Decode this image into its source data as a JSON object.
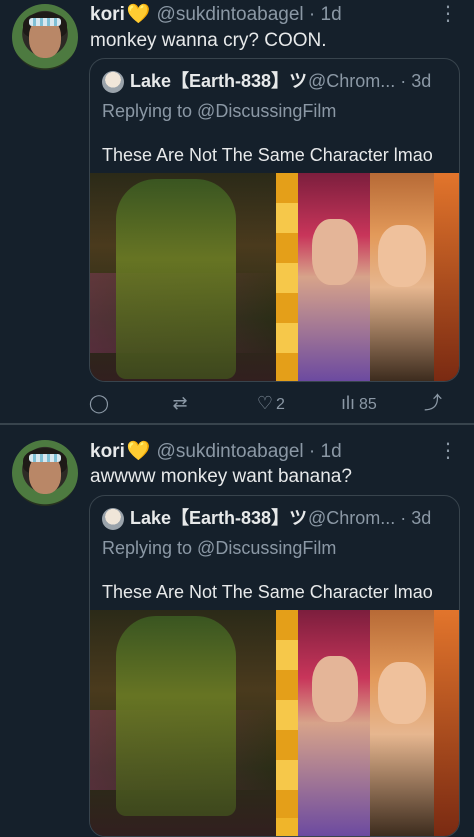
{
  "tweets": [
    {
      "name": "kori",
      "badge": "💛",
      "handle": "@sukdintoabagel · 1d",
      "text": "monkey wanna cry? COON.",
      "quote": {
        "name": "Lake【Earth-838】ツ",
        "handle": "@Chrom... · 3d",
        "replying": "Replying to @DiscussingFilm",
        "text": "These Are Not The Same Character lmao"
      },
      "actions": {
        "reply_count": "",
        "retweet_count": "",
        "like_count": "2",
        "view_count": "85"
      }
    },
    {
      "name": "kori",
      "badge": "💛",
      "handle": "@sukdintoabagel · 1d",
      "text": "awwww monkey want banana?",
      "quote": {
        "name": "Lake【Earth-838】ツ",
        "handle": "@Chrom... · 3d",
        "replying": "Replying to @DiscussingFilm",
        "text": "These Are Not The Same Character lmao"
      }
    }
  ],
  "icons": {
    "more": "more-icon",
    "reply": "reply-icon",
    "retweet": "retweet-icon",
    "like": "heart-icon",
    "views": "views-icon",
    "share": "share-icon"
  },
  "colors": {
    "background": "#15202b",
    "text": "#e7e9ea",
    "secondary_text": "#8b98a5",
    "border": "#38444d",
    "heart_badge": "#f5c518"
  }
}
